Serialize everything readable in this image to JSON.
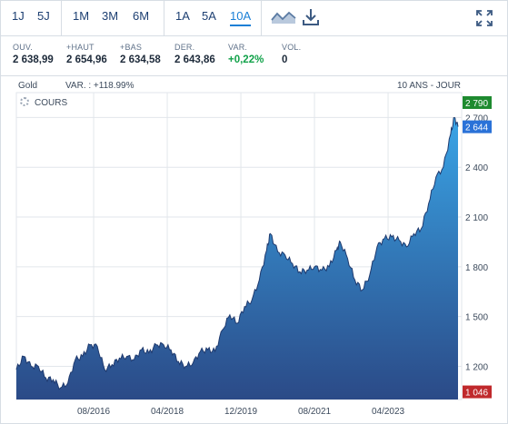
{
  "toolbar": {
    "intraday": [
      "1J",
      "5J"
    ],
    "months": [
      "1M",
      "3M",
      "6M"
    ],
    "years": [
      "1A",
      "5A",
      "10A"
    ],
    "active": "10A",
    "icons": [
      "chart-type-icon",
      "download-icon",
      "fullscreen-icon"
    ]
  },
  "quotes": [
    {
      "label": "OUV.",
      "value": "2 638,99"
    },
    {
      "label": "+HAUT",
      "value": "2 654,96"
    },
    {
      "label": "+BAS",
      "value": "2 634,58"
    },
    {
      "label": "DER.",
      "value": "2 643,86"
    },
    {
      "label": "VAR.",
      "value": "+0,22%"
    },
    {
      "label": "VOL.",
      "value": "0"
    }
  ],
  "chart_info": {
    "instrument": "Gold",
    "variation": "VAR. : +118.99%",
    "period": "10 ANS - JOUR",
    "legend": "COURS"
  },
  "colors": {
    "accent": "#1a7fd6",
    "up": "#12a24a",
    "max_tag": "#1e8a2f",
    "last_tag": "#2a72d8",
    "min_tag": "#c0292c",
    "area_top": "#39a4e6",
    "area_bottom": "#2b4a87"
  },
  "chart_data": {
    "type": "area",
    "series": [
      {
        "name": "COURS",
        "x": [
          "2014-11",
          "2015-01",
          "2015-03",
          "2015-05",
          "2015-07",
          "2015-09",
          "2015-11",
          "2016-01",
          "2016-03",
          "2016-05",
          "2016-07",
          "2016-09",
          "2016-11",
          "2017-01",
          "2017-03",
          "2017-05",
          "2017-07",
          "2017-09",
          "2017-11",
          "2018-01",
          "2018-03",
          "2018-05",
          "2018-07",
          "2018-09",
          "2018-11",
          "2019-01",
          "2019-03",
          "2019-05",
          "2019-07",
          "2019-09",
          "2019-11",
          "2020-01",
          "2020-03",
          "2020-05",
          "2020-07",
          "2020-08",
          "2020-10",
          "2020-12",
          "2021-02",
          "2021-04",
          "2021-06",
          "2021-08",
          "2021-10",
          "2021-12",
          "2022-02",
          "2022-03",
          "2022-05",
          "2022-07",
          "2022-09",
          "2022-11",
          "2023-01",
          "2023-03",
          "2023-05",
          "2023-07",
          "2023-09",
          "2023-11",
          "2024-01",
          "2024-03",
          "2024-05",
          "2024-07",
          "2024-09",
          "2024-10",
          "2024-11"
        ],
        "y": [
          1180,
          1260,
          1200,
          1200,
          1130,
          1120,
          1070,
          1100,
          1240,
          1260,
          1330,
          1320,
          1180,
          1210,
          1250,
          1260,
          1240,
          1300,
          1280,
          1330,
          1330,
          1300,
          1230,
          1200,
          1220,
          1290,
          1300,
          1290,
          1420,
          1510,
          1460,
          1560,
          1600,
          1720,
          1900,
          2000,
          1890,
          1870,
          1820,
          1770,
          1780,
          1800,
          1780,
          1800,
          1900,
          1950,
          1850,
          1720,
          1660,
          1750,
          1920,
          1970,
          1980,
          1960,
          1920,
          2000,
          2030,
          2180,
          2340,
          2400,
          2600,
          2700,
          2644
        ]
      }
    ],
    "y_ticks": [
      "1 200",
      "1 500",
      "1 800",
      "2 100",
      "2 400",
      "2 700"
    ],
    "x_ticks": [
      "08/2016",
      "04/2018",
      "12/2019",
      "08/2021",
      "04/2023"
    ],
    "ylim": [
      1000,
      2850
    ],
    "max_label": "2 790",
    "last_label": "2 644",
    "min_label": "1 046",
    "grid": true
  }
}
